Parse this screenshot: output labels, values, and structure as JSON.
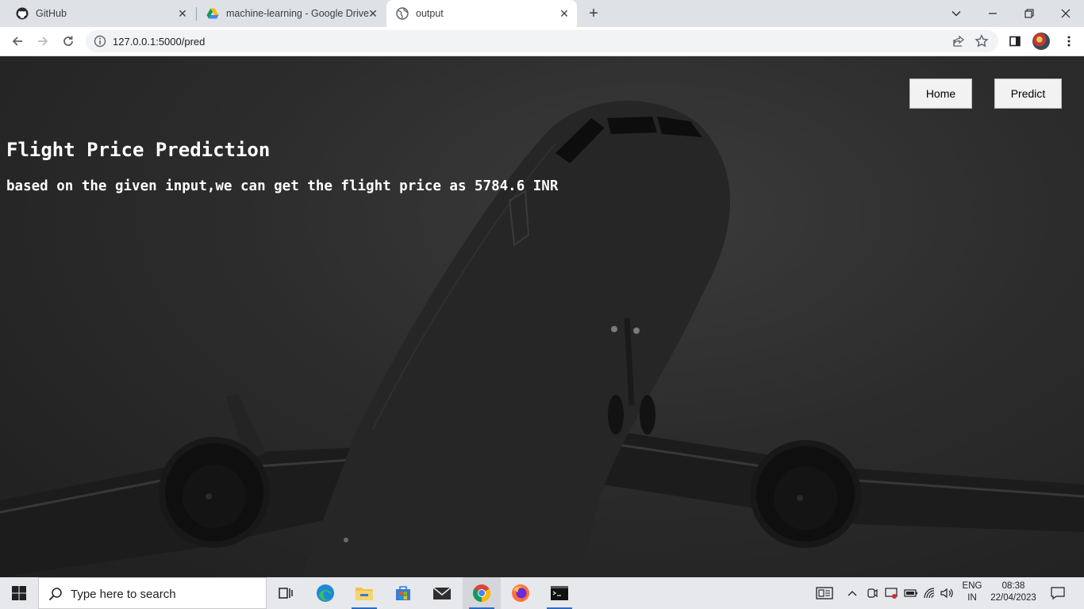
{
  "browser": {
    "tabs": [
      {
        "title": "GitHub",
        "icon": "github-icon",
        "active": false
      },
      {
        "title": "machine-learning - Google Drive",
        "icon": "google-drive-icon",
        "active": false
      },
      {
        "title": "output",
        "icon": "globe-icon",
        "active": true
      }
    ],
    "address_bar": {
      "url": "127.0.0.1:5000/pred",
      "security_icon": "info-icon"
    }
  },
  "page": {
    "nav": {
      "home_label": "Home",
      "predict_label": "Predict"
    },
    "title": "Flight Price Prediction",
    "result_text": "based on the given input,we can get the flight price as 5784.6 INR",
    "background": "airplane-takeoff-photo"
  },
  "taskbar": {
    "search_placeholder": "Type here to search",
    "apps": [
      "task-view-icon",
      "edge-icon",
      "file-explorer-icon",
      "microsoft-store-icon",
      "mail-icon",
      "chrome-icon",
      "firefox-icon",
      "terminal-icon"
    ],
    "language": {
      "line1": "ENG",
      "line2": "IN"
    },
    "clock": {
      "time": "08:38",
      "date": "22/04/2023"
    }
  },
  "colors": {
    "tabstrip": "#dee1e6",
    "page_overlay": "#2c2c2c",
    "taskbar": "#e6e8ec",
    "accent": "#2b6cc4"
  }
}
